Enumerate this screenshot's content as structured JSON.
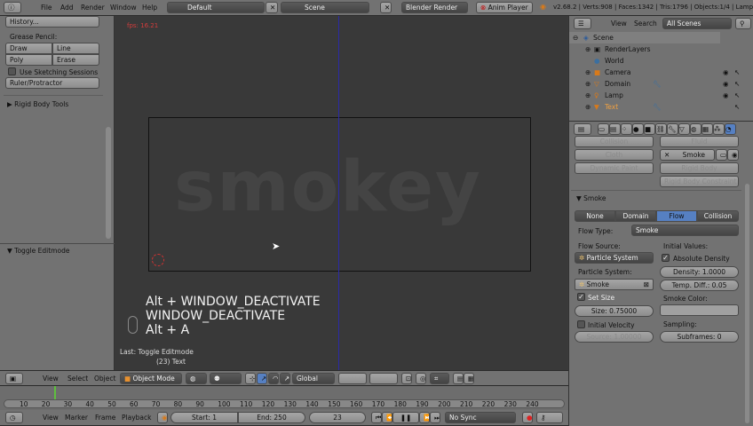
{
  "topbar": {
    "menus": [
      "File",
      "Add",
      "Render",
      "Window",
      "Help"
    ],
    "layout": "Default",
    "scene": "Scene",
    "engine": "Blender Render",
    "anim_player": "Anim Player",
    "stats": "v2.68.2 | Verts:908 | Faces:1342 | Tris:1796 | Objects:1/4 | Lamps:"
  },
  "toolshelf": {
    "history": "History...",
    "grease_pencil": "Grease Pencil:",
    "draw": "Draw",
    "line": "Line",
    "poly": "Poly",
    "erase": "Erase",
    "sketching": "Use Sketching Sessions",
    "ruler": "Ruler/Protractor",
    "rigid_body_tools": "Rigid Body Tools",
    "toggle_editmode": "Toggle Editmode"
  },
  "viewport": {
    "fps": "fps: 16.21",
    "camera_text": "smokey",
    "keys": [
      "Alt + WINDOW_DEACTIVATE",
      "WINDOW_DEACTIVATE",
      "Alt + A"
    ],
    "last_op": "Last: Toggle Editmode",
    "object_info": "(23) Text"
  },
  "view_header": {
    "menus": [
      "View",
      "Select",
      "Object"
    ],
    "mode": "Object Mode",
    "orientation": "Global"
  },
  "timeline": {
    "ticks": [
      "10",
      "20",
      "30",
      "40",
      "50",
      "60",
      "70",
      "80",
      "90",
      "100",
      "110",
      "120",
      "130",
      "140",
      "150",
      "160",
      "170",
      "180",
      "190",
      "200",
      "210",
      "220",
      "230",
      "240"
    ],
    "current_frame_marker": 23,
    "menus": [
      "View",
      "Marker",
      "Frame",
      "Playback"
    ],
    "start": "Start: 1",
    "end": "End: 250",
    "current": "23",
    "sync": "No Sync"
  },
  "outliner": {
    "view": "View",
    "search": "Search",
    "filter": "All Scenes",
    "items": [
      {
        "name": "Scene",
        "icon": "scene"
      },
      {
        "name": "RenderLayers",
        "icon": "renderlayers"
      },
      {
        "name": "World",
        "icon": "world"
      },
      {
        "name": "Camera",
        "icon": "camera"
      },
      {
        "name": "Domain",
        "icon": "mesh"
      },
      {
        "name": "Lamp",
        "icon": "lamp"
      },
      {
        "name": "Text",
        "icon": "mesh"
      }
    ]
  },
  "physics": {
    "collision": "Collision",
    "fluid": "Fluid",
    "cloth": "Cloth",
    "smoke": "Smoke",
    "dynamic_paint": "Dynamic Paint",
    "rigid_body": "Rigid Body",
    "rigid_body_constraint": "Rigid Body Constraint",
    "panel_title": "Smoke",
    "types": [
      "None",
      "Domain",
      "Flow",
      "Collision"
    ],
    "active_type": "Flow",
    "flow_type_label": "Flow Type:",
    "flow_type": "Smoke",
    "flow_source_label": "Flow Source:",
    "flow_source": "Particle System",
    "particle_system_label": "Particle System:",
    "particle_system": "Smoke",
    "set_size": "Set Size",
    "size": "Size: 0.75000",
    "initial_velocity": "Initial Velocity",
    "source": "Source: 1.00000",
    "initial_values": "Initial Values:",
    "absolute_density": "Absolute Density",
    "density": "Density: 1.0000",
    "temp_diff": "Temp. Diff.: 0.05",
    "smoke_color": "Smoke Color:",
    "sampling": "Sampling:",
    "subframes": "Subframes: 0"
  },
  "colors": {
    "accent": "#5680c2",
    "fps": "#d43c3c",
    "current_frame": "#5fbf3f"
  }
}
